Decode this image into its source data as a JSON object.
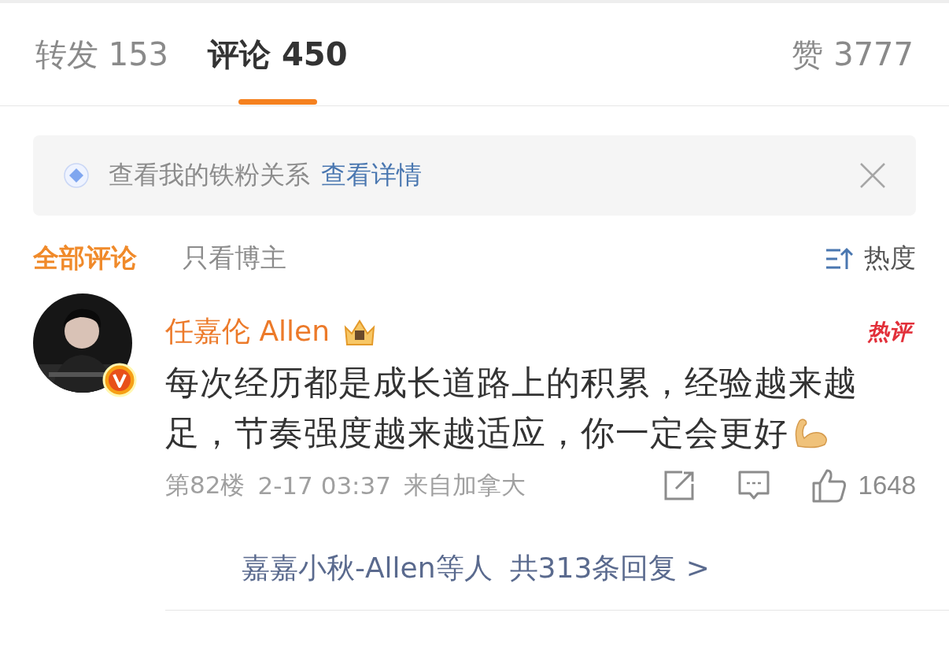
{
  "tabs": [
    {
      "label": "转发",
      "count": "153",
      "selected": false
    },
    {
      "label": "评论",
      "count": "450",
      "selected": true
    }
  ],
  "likes": {
    "label": "赞",
    "count": "3777"
  },
  "banner": {
    "text": "查看我的铁粉关系",
    "link": "查看详情"
  },
  "filters": [
    {
      "label": "全部评论",
      "selected": true
    },
    {
      "label": "只看博主",
      "selected": false
    }
  ],
  "sort": {
    "label": "热度"
  },
  "comments": [
    {
      "author": "任嘉伦 Allen",
      "verified": true,
      "badge": "热评",
      "text": "每次经历都是成长道路上的积累，经验越来越足，节奏强度越来越适应，你一定会更好",
      "meta": {
        "floor": "第82楼",
        "time": "2-17 03:37",
        "location": "来自加拿大"
      },
      "likes": "1648",
      "replies": {
        "names": "嘉嘉小秋-Allen等人",
        "total": "共313条回复 >"
      }
    }
  ]
}
